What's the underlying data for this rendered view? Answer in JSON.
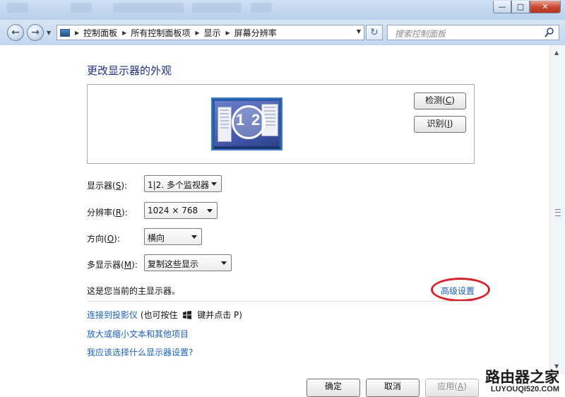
{
  "window": {
    "minimize": "—",
    "maximize": "□",
    "close": "✕"
  },
  "nav": {
    "back_icon": "back-arrow-icon",
    "forward_icon": "forward-arrow-icon",
    "breadcrumbs": [
      "控制面板",
      "所有控制面板项",
      "显示",
      "屏幕分辨率"
    ],
    "search_placeholder": "搜索控制面板"
  },
  "page": {
    "title": "更改显示器的外观",
    "detect_label": "检测",
    "detect_key": "C",
    "identify_label": "识别",
    "identify_key": "I",
    "monitor_numbers": [
      "1",
      "2"
    ]
  },
  "settings": [
    {
      "label": "显示器",
      "key": "S",
      "value": "1|2. 多个监视器"
    },
    {
      "label": "分辨率",
      "key": "R",
      "value": "1024 × 768"
    },
    {
      "label": "方向",
      "key": "O",
      "value": "横向"
    },
    {
      "label": "多显示器",
      "key": "M",
      "value": "复制这些显示"
    }
  ],
  "note": "这是您当前的主显示器。",
  "advanced_link": "高级设置",
  "links": {
    "projector": "连接到投影仪",
    "projector_hint_pre": "(也可按住",
    "projector_hint_post": "键并点击 P)",
    "text_size": "放大或缩小文本和其他项目",
    "which_settings": "我应该选择什么显示器设置?"
  },
  "footer": {
    "ok": "确定",
    "cancel": "取消",
    "apply": "应用",
    "apply_key": "A"
  },
  "watermark": {
    "cn": "路由器之家",
    "en": "LUYOUQI520.COM"
  },
  "colors": {
    "accent_link": "#1b5fb5",
    "title": "#1e3287",
    "highlight_ring": "#d8222b"
  }
}
